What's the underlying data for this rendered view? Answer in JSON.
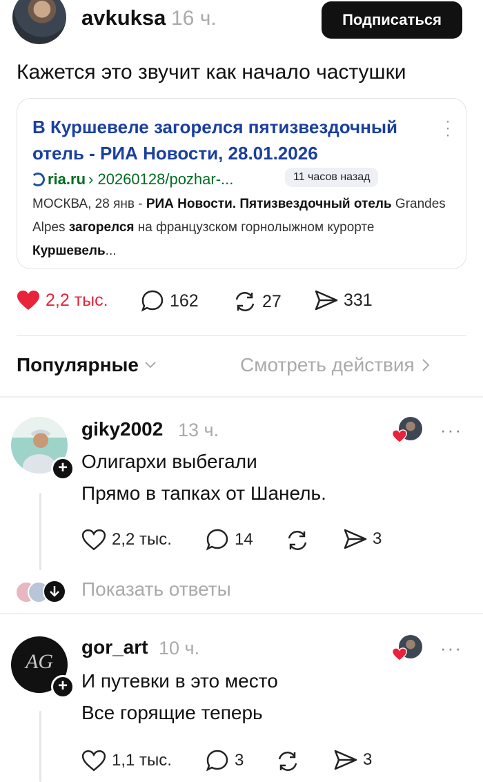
{
  "post": {
    "username": "avkuksa",
    "time": "16 ч.",
    "subscribe_label": "Подписаться",
    "text": "Кажется это звучит как начало частушки",
    "card": {
      "title": "В Куршевеле загорелся пятизвездочный отель - РИА Новости, 28.01.2026",
      "source_domain": "ria.ru",
      "source_path": "› 20260128/pozhar-...",
      "badge": "11 часов назад",
      "snippet_parts": {
        "p1": "МОСКВА, 28 янв - ",
        "b1": "РИА Новости. Пятизвездочный отель",
        "p2": " Grandes Alpes ",
        "b2": "загорелся",
        "p3": " на французском горнолыжном курорте ",
        "b3": "Куршевель",
        "p4": "..."
      }
    },
    "stats": {
      "likes": "2,2 тыс.",
      "comments": "162",
      "reposts": "27",
      "shares": "331"
    }
  },
  "sort": {
    "popular_label": "Популярные",
    "view_actions_label": "Смотреть действия"
  },
  "comments": [
    {
      "username": "giky2002",
      "time": "13 ч.",
      "line1": "Олигархи выбегали",
      "line2": "Прямо в тапках от Шанель.",
      "likes": "2,2 тыс.",
      "comments": "14",
      "shares": "3",
      "show_replies": "Показать ответы"
    },
    {
      "username": "gor_art",
      "time": "10 ч.",
      "line1": "И путевки в это место",
      "line2": "Все горящие теперь",
      "likes": "1,1 тыс.",
      "comments": "3",
      "shares": "3",
      "avatar_logo": "AG"
    }
  ],
  "colors": {
    "heart": "#e8233a",
    "link_title": "#1a3f9f",
    "source_green": "#006b23",
    "muted": "#aaaaaa"
  }
}
